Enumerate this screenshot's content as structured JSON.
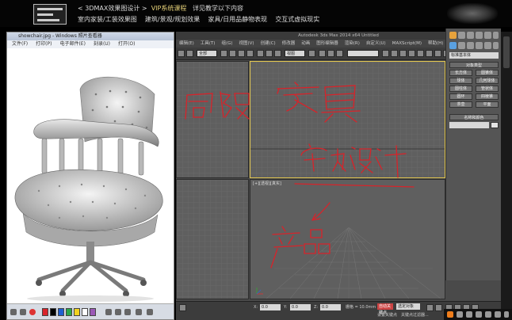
{
  "banner": {
    "line1_prefix": "< 3DMAX效果图设计 >",
    "line1_mid": "VIP系统课程",
    "line1_suffix": "详见教学以下内容",
    "line2_a": "室内家装/工装效果图",
    "line2_b": "建筑/景观/规划效果",
    "line2_c": "家具/日用品静物表现",
    "line2_d": "交互式虚拟现实"
  },
  "viewer": {
    "title": "showchair.jpg - Windows 照片查看器",
    "menu": [
      "文件(F)",
      "打印(P)",
      "电子邮件(E)",
      "刻录(U)",
      "打开(O)"
    ]
  },
  "max": {
    "title": "Autodesk 3ds Max 2014 x64   Untitled",
    "menu": [
      "编辑(E)",
      "工具(T)",
      "组(G)",
      "视图(V)",
      "创建(C)",
      "修改器",
      "动画",
      "图形编辑器",
      "渲染(R)",
      "自定义(U)",
      "MAXScript(M)",
      "帮助(H)"
    ],
    "toolbar_dd": "全部",
    "toolbar_dd2": "视图",
    "persp_label": "[+][透视][真实]",
    "status": {
      "x_label": "X:",
      "x_val": "0.0",
      "y_label": "Y:",
      "y_val": "0.0",
      "z_label": "Z:",
      "z_val": "0.0",
      "grid": "栅格 = 10.0mm",
      "autokey": "自动关键点",
      "selected": "选定对象",
      "setkey": "设置关键点",
      "filters": "关键点过滤器..."
    }
  },
  "cmd": {
    "category": "标准基本体",
    "object_type": "对象类型",
    "buttons": [
      "长方体",
      "圆锥体",
      "球体",
      "几何球体",
      "圆柱体",
      "管状体",
      "圆环",
      "四棱锥",
      "茶壶",
      "平面"
    ],
    "name_color": "名称和颜色"
  },
  "annotations": {
    "a1": "局限",
    "a2": "家具",
    "a3": "室内设计",
    "a4": "产品"
  },
  "colors": {
    "active_border": "#e2c64f",
    "annotation": "#d8232a"
  }
}
